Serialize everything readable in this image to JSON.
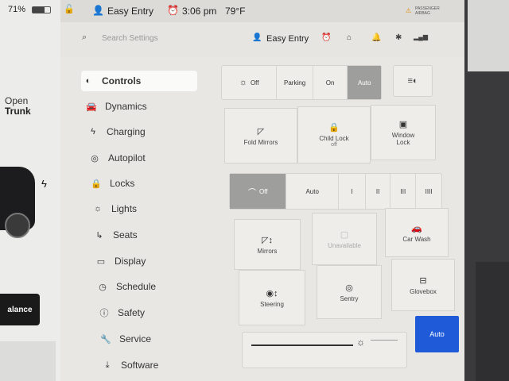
{
  "status": {
    "battery": "71%",
    "profile": "Easy Entry",
    "time": "3:06 pm",
    "temp": "79°F",
    "airbag_line1": "PASSENGER",
    "airbag_line2": "AIRBAG"
  },
  "left": {
    "trunk_line1": "Open",
    "trunk_line2": "Trunk",
    "balance": "alance"
  },
  "search": {
    "placeholder": "Search Settings",
    "profile": "Easy Entry"
  },
  "menu": [
    {
      "label": "Controls",
      "icon": "toggle-icon"
    },
    {
      "label": "Dynamics",
      "icon": "car-icon"
    },
    {
      "label": "Charging",
      "icon": "bolt-icon"
    },
    {
      "label": "Autopilot",
      "icon": "steering-wheel-icon"
    },
    {
      "label": "Locks",
      "icon": "lock-icon"
    },
    {
      "label": "Lights",
      "icon": "sun-icon"
    },
    {
      "label": "Seats",
      "icon": "seat-icon"
    },
    {
      "label": "Display",
      "icon": "display-icon"
    },
    {
      "label": "Schedule",
      "icon": "clock-icon"
    },
    {
      "label": "Safety",
      "icon": "alert-icon"
    },
    {
      "label": "Service",
      "icon": "wrench-icon"
    },
    {
      "label": "Software",
      "icon": "download-icon"
    }
  ],
  "lights_mode": {
    "options": [
      "Off",
      "Parking",
      "On",
      "Auto"
    ],
    "selected": "Auto"
  },
  "mirror_row": {
    "fold_mirrors": "Fold Mirrors",
    "child_lock_line1": "Child Lock",
    "child_lock_line2": "off",
    "window_lock_line1": "Window",
    "window_lock_line2": "Lock"
  },
  "wipers": {
    "options": [
      "Off",
      "Auto",
      "I",
      "II",
      "III",
      "IIII"
    ],
    "selected": "Off"
  },
  "grid": {
    "mirrors": "Mirrors",
    "unavailable": "Unavailable",
    "car_wash": "Car Wash",
    "steering": "Steering",
    "sentry": "Sentry",
    "glovebox": "Glovebox"
  },
  "brightness": {
    "auto_label": "Auto"
  },
  "colors": {
    "accent": "#1f5bd8",
    "selected_segment": "#9e9e9c"
  }
}
